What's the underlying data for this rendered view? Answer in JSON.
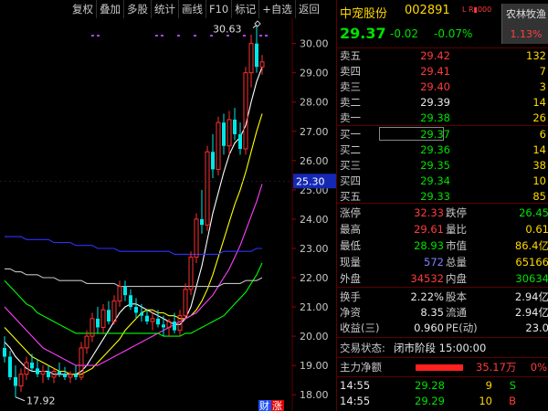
{
  "toolbar": {
    "buttons": [
      "复权",
      "叠加",
      "多股",
      "统计",
      "画线",
      "F10",
      "标记",
      "+自选",
      "返回"
    ]
  },
  "chart": {
    "price_axis": [
      "30.00",
      "29.00",
      "28.00",
      "27.00",
      "26.00",
      "25.00",
      "24.00",
      "23.00",
      "22.00",
      "21.00",
      "20.00",
      "19.00",
      "18.00"
    ],
    "high_marker": "30.63",
    "low_marker": "17.92",
    "cursor_price": "25.30",
    "bottom_tags": [
      "财",
      "涨"
    ]
  },
  "chart_data": {
    "type": "candlestick",
    "y_range": [
      17.6,
      30.8
    ],
    "candles": [
      {
        "o": 19.6,
        "h": 20.0,
        "l": 19.1,
        "c": 19.3
      },
      {
        "o": 19.3,
        "h": 19.5,
        "l": 18.5,
        "c": 18.6
      },
      {
        "o": 18.6,
        "h": 19.0,
        "l": 17.92,
        "c": 18.3
      },
      {
        "o": 18.3,
        "h": 18.9,
        "l": 18.1,
        "c": 18.7
      },
      {
        "o": 18.7,
        "h": 19.3,
        "l": 18.5,
        "c": 19.1
      },
      {
        "o": 19.1,
        "h": 19.4,
        "l": 18.8,
        "c": 18.9
      },
      {
        "o": 18.9,
        "h": 19.2,
        "l": 18.6,
        "c": 18.7
      },
      {
        "o": 18.7,
        "h": 19.0,
        "l": 18.4,
        "c": 18.8
      },
      {
        "o": 18.8,
        "h": 19.0,
        "l": 18.5,
        "c": 18.6
      },
      {
        "o": 18.6,
        "h": 18.9,
        "l": 18.4,
        "c": 18.8
      },
      {
        "o": 18.8,
        "h": 19.1,
        "l": 18.6,
        "c": 18.7
      },
      {
        "o": 18.7,
        "h": 18.95,
        "l": 18.5,
        "c": 18.6
      },
      {
        "o": 18.6,
        "h": 18.8,
        "l": 18.4,
        "c": 18.7
      },
      {
        "o": 18.7,
        "h": 19.0,
        "l": 18.5,
        "c": 18.6
      },
      {
        "o": 18.6,
        "h": 19.8,
        "l": 18.5,
        "c": 19.6
      },
      {
        "o": 19.6,
        "h": 20.2,
        "l": 19.4,
        "c": 20.0
      },
      {
        "o": 20.0,
        "h": 20.8,
        "l": 19.8,
        "c": 20.6
      },
      {
        "o": 20.6,
        "h": 21.0,
        "l": 20.1,
        "c": 20.3
      },
      {
        "o": 20.3,
        "h": 21.1,
        "l": 20.1,
        "c": 20.9
      },
      {
        "o": 20.9,
        "h": 21.2,
        "l": 20.4,
        "c": 20.5
      },
      {
        "o": 20.5,
        "h": 21.4,
        "l": 20.4,
        "c": 21.2
      },
      {
        "o": 21.2,
        "h": 21.9,
        "l": 21.0,
        "c": 21.7
      },
      {
        "o": 21.7,
        "h": 21.9,
        "l": 21.2,
        "c": 21.4
      },
      {
        "o": 21.4,
        "h": 21.6,
        "l": 20.9,
        "c": 21.0
      },
      {
        "o": 21.0,
        "h": 21.3,
        "l": 20.6,
        "c": 20.8
      },
      {
        "o": 20.8,
        "h": 21.1,
        "l": 20.5,
        "c": 20.7
      },
      {
        "o": 20.7,
        "h": 20.9,
        "l": 20.4,
        "c": 20.5
      },
      {
        "o": 20.5,
        "h": 20.8,
        "l": 20.2,
        "c": 20.6
      },
      {
        "o": 20.6,
        "h": 20.9,
        "l": 20.3,
        "c": 20.4
      },
      {
        "o": 20.4,
        "h": 20.7,
        "l": 20.0,
        "c": 20.3
      },
      {
        "o": 20.3,
        "h": 20.6,
        "l": 20.0,
        "c": 20.5
      },
      {
        "o": 20.5,
        "h": 20.8,
        "l": 20.1,
        "c": 20.2
      },
      {
        "o": 20.2,
        "h": 20.9,
        "l": 20.0,
        "c": 20.7
      },
      {
        "o": 20.7,
        "h": 21.8,
        "l": 20.6,
        "c": 21.6
      },
      {
        "o": 21.6,
        "h": 22.9,
        "l": 21.4,
        "c": 22.7
      },
      {
        "o": 22.7,
        "h": 24.2,
        "l": 22.5,
        "c": 24.0
      },
      {
        "o": 24.0,
        "h": 25.0,
        "l": 23.5,
        "c": 23.8
      },
      {
        "o": 23.8,
        "h": 26.5,
        "l": 23.6,
        "c": 26.3
      },
      {
        "o": 26.3,
        "h": 26.9,
        "l": 25.4,
        "c": 25.7
      },
      {
        "o": 25.7,
        "h": 27.5,
        "l": 25.5,
        "c": 27.3
      },
      {
        "o": 27.3,
        "h": 27.6,
        "l": 26.2,
        "c": 26.5
      },
      {
        "o": 26.5,
        "h": 27.7,
        "l": 26.2,
        "c": 27.4
      },
      {
        "o": 27.4,
        "h": 27.8,
        "l": 26.7,
        "c": 26.9
      },
      {
        "o": 26.9,
        "h": 27.3,
        "l": 26.2,
        "c": 26.4
      },
      {
        "o": 26.4,
        "h": 29.2,
        "l": 26.2,
        "c": 29.0
      },
      {
        "o": 29.0,
        "h": 30.3,
        "l": 28.5,
        "c": 30.0
      },
      {
        "o": 30.0,
        "h": 30.63,
        "l": 29.0,
        "c": 29.2
      },
      {
        "o": 29.2,
        "h": 29.61,
        "l": 28.93,
        "c": 29.37
      }
    ],
    "moving_averages": [
      {
        "name": "MA5",
        "color": "#ffffff",
        "values": [
          19.8,
          19.6,
          19.3,
          19.1,
          18.9,
          18.8,
          18.8,
          18.8,
          18.8,
          18.7,
          18.7,
          18.7,
          18.7,
          18.7,
          18.8,
          19.0,
          19.3,
          19.6,
          19.9,
          20.2,
          20.5,
          20.8,
          21.0,
          21.1,
          21.1,
          21.0,
          20.9,
          20.8,
          20.7,
          20.6,
          20.5,
          20.4,
          20.4,
          20.6,
          21.0,
          21.7,
          22.4,
          23.3,
          24.2,
          24.9,
          25.6,
          26.2,
          26.6,
          26.8,
          27.2,
          28.0,
          28.7,
          29.2
        ]
      },
      {
        "name": "MA10",
        "color": "#ffff00",
        "values": [
          20.3,
          20.1,
          19.9,
          19.7,
          19.5,
          19.3,
          19.2,
          19.1,
          19.0,
          18.9,
          18.8,
          18.8,
          18.7,
          18.7,
          18.7,
          18.8,
          18.9,
          19.1,
          19.3,
          19.5,
          19.7,
          19.9,
          20.2,
          20.4,
          20.6,
          20.8,
          20.9,
          20.9,
          20.8,
          20.8,
          20.7,
          20.7,
          20.6,
          20.6,
          20.7,
          20.9,
          21.2,
          21.6,
          22.1,
          22.7,
          23.3,
          23.9,
          24.5,
          25.0,
          25.6,
          26.3,
          27.0,
          27.6
        ]
      },
      {
        "name": "MA20",
        "color": "#ff40ff",
        "values": [
          21.0,
          20.8,
          20.6,
          20.4,
          20.2,
          20.0,
          19.8,
          19.6,
          19.5,
          19.4,
          19.3,
          19.2,
          19.1,
          19.0,
          19.0,
          19.0,
          19.0,
          19.0,
          19.1,
          19.2,
          19.3,
          19.4,
          19.5,
          19.6,
          19.7,
          19.8,
          19.9,
          20.0,
          20.1,
          20.2,
          20.3,
          20.4,
          20.5,
          20.6,
          20.7,
          20.8,
          21.0,
          21.2,
          21.4,
          21.7,
          22.0,
          22.3,
          22.7,
          23.1,
          23.6,
          24.1,
          24.6,
          25.2
        ]
      },
      {
        "name": "MA30",
        "color": "#00ff00",
        "values": [
          21.9,
          21.7,
          21.5,
          21.3,
          21.1,
          21.0,
          20.8,
          20.7,
          20.6,
          20.5,
          20.4,
          20.3,
          20.2,
          20.1,
          20.1,
          20.1,
          20.1,
          20.1,
          20.1,
          20.1,
          20.1,
          20.1,
          20.1,
          20.1,
          20.1,
          20.1,
          20.1,
          20.1,
          20.1,
          20.0,
          20.0,
          20.0,
          20.0,
          20.1,
          20.1,
          20.2,
          20.3,
          20.4,
          20.5,
          20.6,
          20.7,
          20.9,
          21.1,
          21.3,
          21.5,
          21.8,
          22.1,
          22.5
        ]
      },
      {
        "name": "MA60",
        "color": "#c0c0c0",
        "values": [
          22.3,
          22.3,
          22.2,
          22.2,
          22.1,
          22.1,
          22.1,
          22.0,
          22.0,
          22.0,
          21.9,
          21.9,
          21.9,
          21.9,
          21.9,
          21.8,
          21.8,
          21.8,
          21.8,
          21.8,
          21.8,
          21.7,
          21.7,
          21.7,
          21.7,
          21.7,
          21.7,
          21.7,
          21.7,
          21.7,
          21.7,
          21.7,
          21.7,
          21.7,
          21.7,
          21.7,
          21.7,
          21.7,
          21.7,
          21.7,
          21.8,
          21.8,
          21.8,
          21.8,
          21.9,
          21.9,
          21.9,
          22.0
        ]
      },
      {
        "name": "MA120",
        "color": "#3030ff",
        "values": [
          23.4,
          23.4,
          23.4,
          23.4,
          23.3,
          23.3,
          23.3,
          23.3,
          23.3,
          23.2,
          23.2,
          23.2,
          23.2,
          23.1,
          23.1,
          23.1,
          23.1,
          23.0,
          23.0,
          23.0,
          23.0,
          22.9,
          22.9,
          22.9,
          22.9,
          22.9,
          22.9,
          22.9,
          22.9,
          22.9,
          22.9,
          22.8,
          22.8,
          22.8,
          22.8,
          22.8,
          22.8,
          22.8,
          22.8,
          22.8,
          22.9,
          22.9,
          22.9,
          22.9,
          22.9,
          22.9,
          23.0,
          23.0
        ]
      }
    ]
  },
  "quote": {
    "name": "中宠股份",
    "code": "002891",
    "flags": "L R▮000",
    "sector": "农林牧渔",
    "sector_change": "1.13%",
    "last": "29.37",
    "change": "-0.02",
    "change_pct": "-0.07%",
    "asks": [
      {
        "label": "卖五",
        "price": "29.42",
        "vol": "132",
        "color": "red"
      },
      {
        "label": "卖四",
        "price": "29.41",
        "vol": "7",
        "color": "red"
      },
      {
        "label": "卖三",
        "price": "29.40",
        "vol": "3",
        "color": "red"
      },
      {
        "label": "卖二",
        "price": "29.39",
        "vol": "14",
        "color": "white"
      },
      {
        "label": "卖一",
        "price": "29.38",
        "vol": "26",
        "color": "green"
      }
    ],
    "bids": [
      {
        "label": "买一",
        "price": "29.37",
        "vol": "6",
        "color": "green"
      },
      {
        "label": "买二",
        "price": "29.36",
        "vol": "14",
        "color": "green"
      },
      {
        "label": "买三",
        "price": "29.35",
        "vol": "38",
        "color": "green"
      },
      {
        "label": "买四",
        "price": "29.34",
        "vol": "10",
        "color": "green"
      },
      {
        "label": "买五",
        "price": "29.33",
        "vol": "85",
        "color": "green"
      }
    ],
    "stats_left": [
      {
        "label": "涨停",
        "value": "32.33",
        "color": "red"
      },
      {
        "label": "最高",
        "value": "29.61",
        "color": "red"
      },
      {
        "label": "最低",
        "value": "28.93",
        "color": "green"
      },
      {
        "label": "现量",
        "value": "572",
        "color": "blue"
      },
      {
        "label": "外盘",
        "value": "34532",
        "color": "red"
      }
    ],
    "stats_right": [
      {
        "label": "跌停",
        "value": "26.45",
        "color": "green"
      },
      {
        "label": "量比",
        "value": "0.61",
        "color": "yellow"
      },
      {
        "label": "市值",
        "value": "86.4亿",
        "color": "yellow"
      },
      {
        "label": "总量",
        "value": "65166",
        "color": "yellow"
      },
      {
        "label": "内盘",
        "value": "30634",
        "color": "green"
      }
    ],
    "stats2_left": [
      {
        "label": "换手",
        "value": "2.22%"
      },
      {
        "label": "净资",
        "value": "8.35"
      },
      {
        "label": "收益(三)",
        "value": "0.960"
      }
    ],
    "stats2_right": [
      {
        "label": "股本",
        "value": "2.94亿"
      },
      {
        "label": "流通",
        "value": "2.94亿"
      },
      {
        "label": "PE(动)",
        "value": "23.0"
      }
    ],
    "trade_status_label": "交易状态:",
    "trade_status": "闭市阶段 15:00:00",
    "net_flow_label": "主力净额",
    "net_flow_value": "35.17万",
    "net_flow_pct": "0%",
    "net_flow_bar_fraction": 0.65,
    "ticks": [
      {
        "time": "14:55",
        "price": "29.28",
        "vol": "9",
        "side": "S",
        "side_color": "green",
        "price_color": "green"
      },
      {
        "time": "14:55",
        "price": "29.29",
        "vol": "10",
        "side": "B",
        "side_color": "red",
        "price_color": "green"
      }
    ]
  }
}
